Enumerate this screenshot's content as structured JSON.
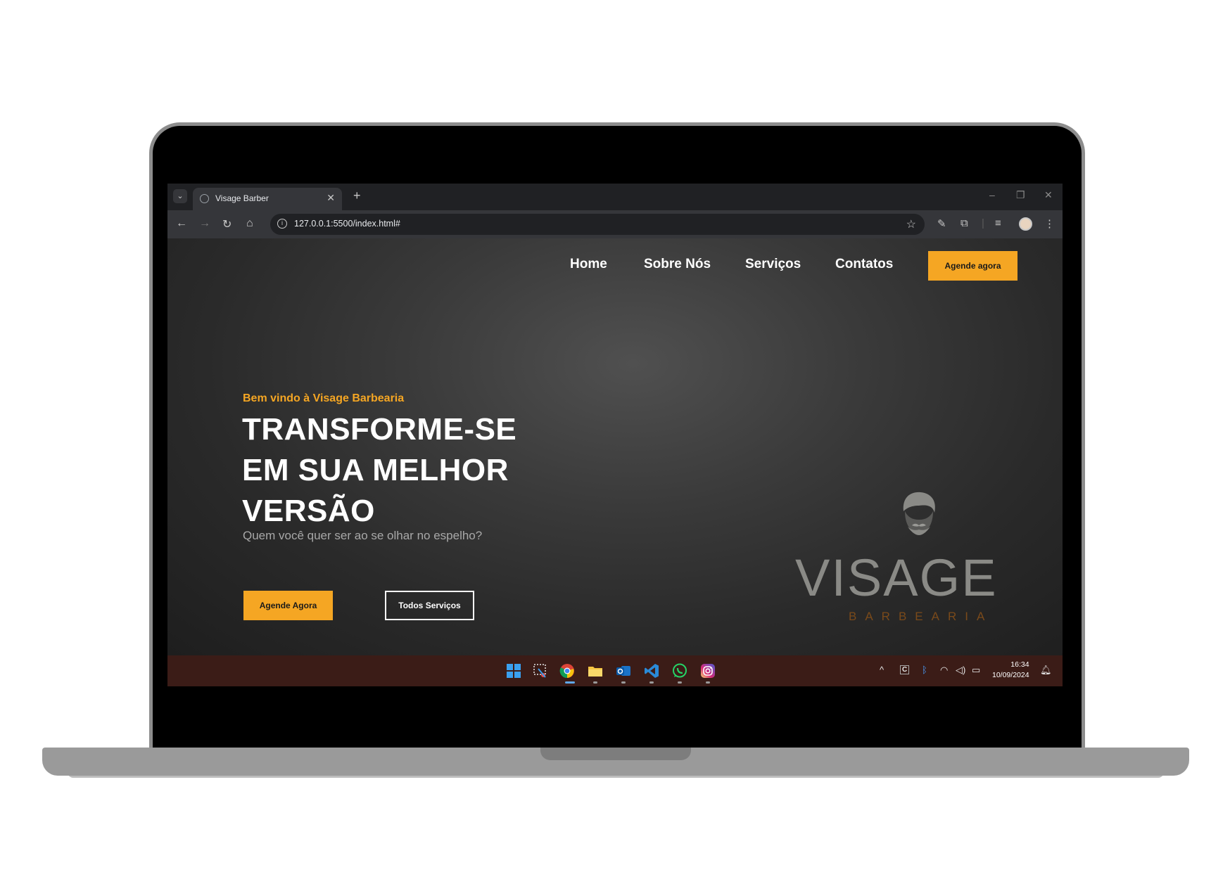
{
  "browser": {
    "tab_title": "Visage Barber",
    "url": "127.0.0.1:5500/index.html#"
  },
  "site": {
    "nav": {
      "home": "Home",
      "about": "Sobre Nós",
      "services": "Serviços",
      "contacts": "Contatos",
      "cta": "Agende agora"
    },
    "hero": {
      "welcome": "Bem vindo à Visage Barbearia",
      "headline": "TRANSFORME-SE EM SUA MELHOR VERSÃO",
      "subtitle": "Quem você quer ser ao se olhar no espelho?",
      "primary_button": "Agende Agora",
      "secondary_button": "Todos Serviços"
    },
    "logo": {
      "name": "VISAGE",
      "sub": "BARBEARIA"
    },
    "colors": {
      "accent": "#f5a623",
      "background": "#2e2e2e",
      "taskbar": "#3b1c17"
    }
  },
  "taskbar": {
    "apps": [
      "windows-start-icon",
      "snipping-tool-icon",
      "chrome-icon",
      "file-explorer-icon",
      "outlook-icon",
      "vscode-icon",
      "whatsapp-icon",
      "instagram-icon"
    ],
    "time": "16:34",
    "date": "10/09/2024"
  }
}
